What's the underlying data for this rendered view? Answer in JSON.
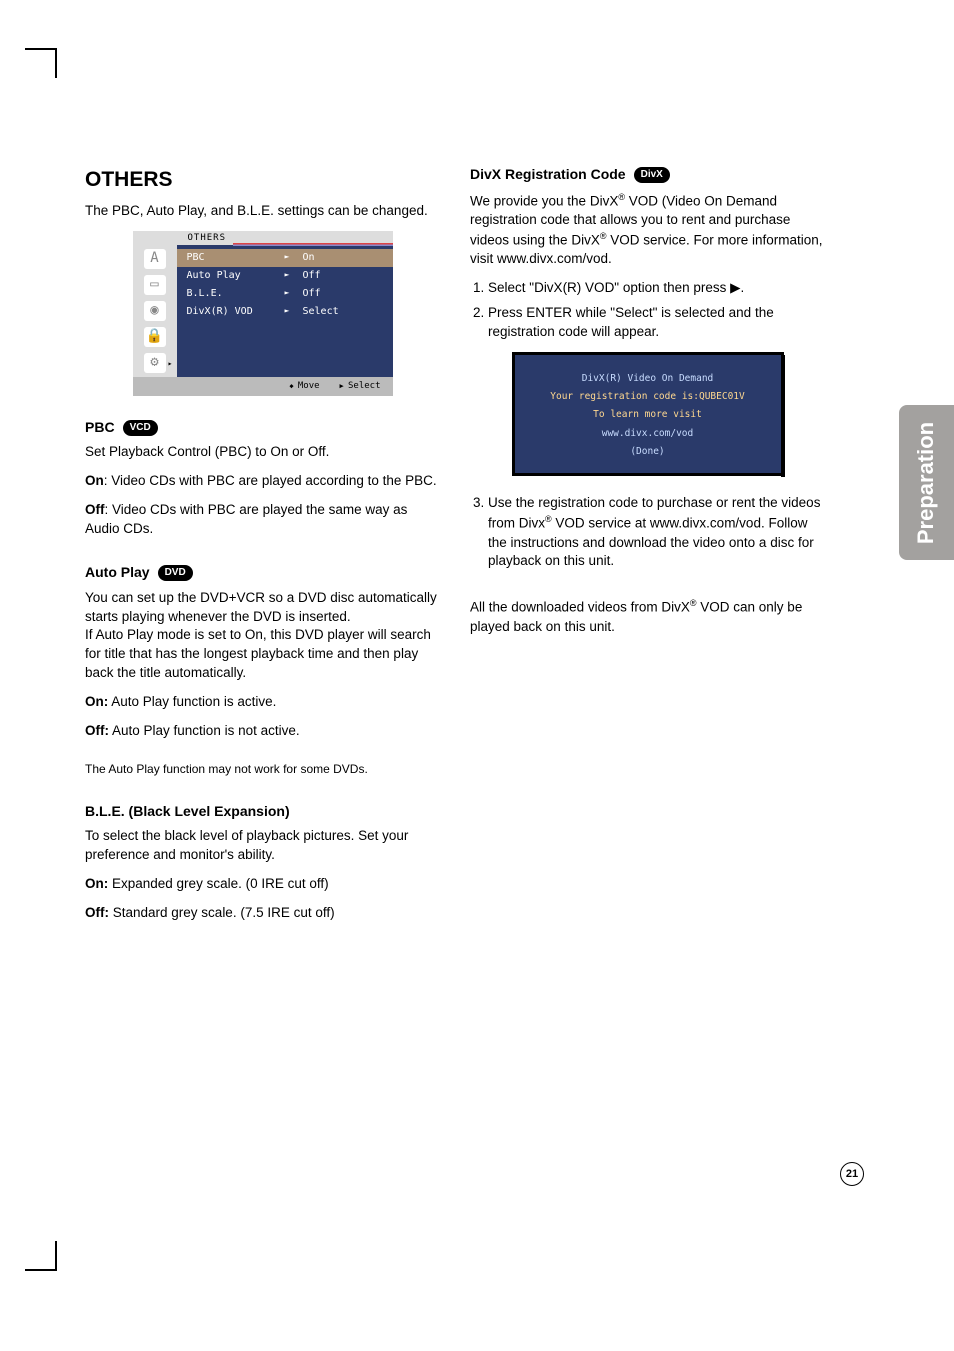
{
  "sidetab": "Preparation",
  "page_number": "21",
  "left": {
    "h1": "OTHERS",
    "intro": "The PBC, Auto Play, and B.L.E. settings can be changed.",
    "osd": {
      "header": "OTHERS",
      "items": [
        {
          "k": "PBC",
          "v": "On",
          "sel": true
        },
        {
          "k": "Auto Play",
          "v": "Off"
        },
        {
          "k": "B.L.E.",
          "v": "Off"
        },
        {
          "k": "DivX(R) VOD",
          "v": "Select"
        }
      ],
      "footer_move": "Move",
      "footer_select": "Select"
    },
    "pbc": {
      "title": "PBC",
      "badge": "VCD",
      "p1": "Set Playback Control (PBC) to On or Off.",
      "on_label": "On",
      "on_text": ": Video CDs with PBC are played according to the PBC.",
      "off_label": "Off",
      "off_text": ": Video CDs with PBC are played the same way as Audio CDs."
    },
    "autoplay": {
      "title": "Auto Play",
      "badge": "DVD",
      "p1": "You can set up the DVD+VCR so a DVD disc automatically starts playing whenever the DVD is inserted.",
      "p2": "If Auto Play mode is set to On, this DVD player will search for title that has the longest playback time and then play back the title automatically.",
      "on_label": "On:",
      "on_text": " Auto Play function is active.",
      "off_label": "Off:",
      "off_text": " Auto Play function is not active.",
      "note": "The Auto Play function may not work for some DVDs."
    },
    "ble": {
      "title": "B.L.E. (Black Level Expansion)",
      "p1": "To select the black level of playback pictures. Set your preference and monitor's ability.",
      "on_label": "On:",
      "on_text": " Expanded grey scale. (0 IRE cut off)",
      "off_label": "Off:",
      "off_text": " Standard grey scale. (7.5 IRE cut off)"
    }
  },
  "right": {
    "divx": {
      "title": "DivX Registration Code",
      "badge": "DivX",
      "p1a": "We provide you the DivX",
      "p1b": " VOD (Video On Demand registration code that allows you to rent and purchase videos using the DivX",
      "p1c": " VOD service. For more information, visit www.divx.com/vod.",
      "step1": "Select \"DivX(R) VOD\" option then press ▶.",
      "step2": "Press ENTER while \"Select\" is selected and the registration code will appear.",
      "box": {
        "l1": "DivX(R) Video On Demand",
        "l2": "Your registration code is:QUBEC01V",
        "l3": "To learn more visit",
        "l4": "www.divx.com/vod",
        "l5": "(Done)"
      },
      "step3a": "Use the registration code to purchase or rent the videos from Divx",
      "step3b": " VOD service at www.divx.com/vod. Follow the instructions and download the video onto a disc for playback on this unit.",
      "note_a": "All the downloaded videos from DivX",
      "note_b": " VOD can only be played back on this unit."
    }
  }
}
